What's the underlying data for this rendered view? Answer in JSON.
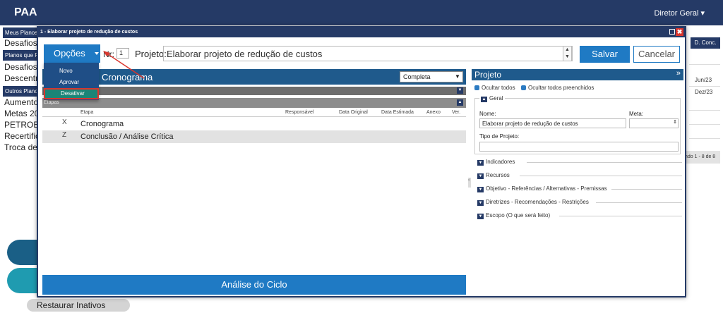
{
  "app": {
    "title": "PAA",
    "user_menu": "Diretor Geral ▾"
  },
  "background": {
    "sections": [
      "Meus Planos",
      "Planos que P",
      "Outros Planos"
    ],
    "items_a": [
      "Desafios"
    ],
    "items_b": [
      "Desafios",
      "Descentra"
    ],
    "items_c": [
      "Aumento",
      "Metas 20",
      "PETROBR",
      "Recertific",
      "Troca de"
    ],
    "right_header": "D. Conc.",
    "dates": [
      "Jun/23",
      "Dez/23"
    ],
    "pager": "ndo 1 - 8 de 8",
    "restore_button": "Restaurar Inativos"
  },
  "modal": {
    "title": "1 - Elaborar projeto de redução de custos",
    "close_icon": "✖"
  },
  "toolbar": {
    "opcoes_label": "Opções",
    "nr_label": "Nr:",
    "nr_value": "1",
    "projeto_label": "Projeto:",
    "projeto_value": "Elaborar projeto de redução de custos",
    "save_label": "Salvar",
    "cancel_label": "Cancelar"
  },
  "opcoes_menu": {
    "items": [
      "Novo",
      "Aprovar",
      "Desativar"
    ],
    "selected": "Desativar"
  },
  "cronograma": {
    "title": "Cronograma",
    "view_select": "Completa",
    "subheader": "Etapas",
    "columns": [
      "Etapa",
      "Responsável",
      "Data Original",
      "Data Estimada",
      "Anexo",
      "Ver."
    ],
    "rows": [
      {
        "mark": "X",
        "name": "Cronograma"
      },
      {
        "mark": "Z",
        "name": "Conclusão / Análise Crítica"
      }
    ],
    "footer_button": "Análise do Ciclo"
  },
  "projeto": {
    "title": "Projeto",
    "tools": [
      "Ocultar todos",
      "Ocultar todos preenchidos"
    ],
    "geral_label": "Geral",
    "nome_label": "Nome:",
    "nome_value": "Elaborar projeto de redução de custos",
    "meta_label": "Meta:",
    "meta_value": "",
    "tipo_label": "Tipo de Projeto:",
    "tipo_value": "",
    "sections": [
      "Indicadores",
      "Recursos",
      "Objetivo - Referências / Alternativas - Premissas",
      "Diretrizes - Recomendações - Restrições",
      "Escopo (O que será feito)"
    ]
  },
  "colors": {
    "brand_dark": "#253a66",
    "accent_blue": "#1f7ac4",
    "panel_blue": "#1f5a8c",
    "highlight_red": "#d9362e",
    "menu_selected": "#1b8577"
  }
}
